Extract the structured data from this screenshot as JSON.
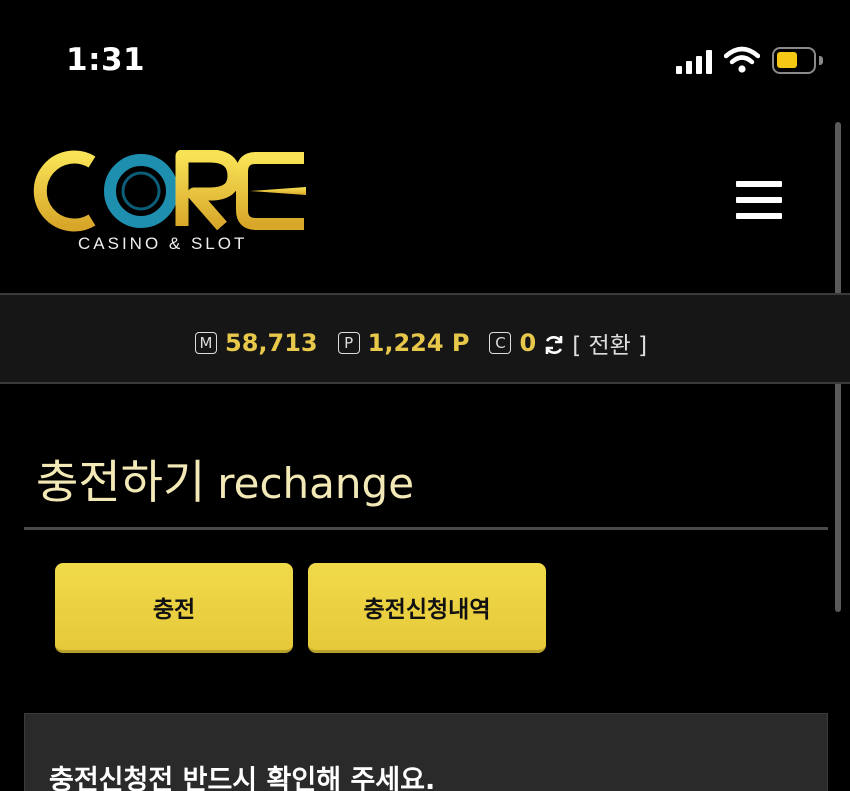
{
  "status_bar": {
    "time": "1:31"
  },
  "header": {
    "logo_text": "CORE",
    "logo_subtitle": "CASINO & SLOT"
  },
  "balance": {
    "money_icon": "M",
    "money_value": "58,713",
    "point_icon": "P",
    "point_value": "1,224 P",
    "coin_icon": "C",
    "coin_value": "0",
    "switch_label": "[ 전환 ]"
  },
  "page": {
    "title_ko": "충전하기",
    "title_en": "rechange"
  },
  "buttons": {
    "charge_label": "충전",
    "history_label": "충전신청내역"
  },
  "notice": {
    "title": "충전신청전 반드시 확인해 주세요."
  },
  "colors": {
    "accent": "#e7c84a",
    "button": "#ead246",
    "logo_ring": "#1f8fb0",
    "background": "#000000"
  }
}
